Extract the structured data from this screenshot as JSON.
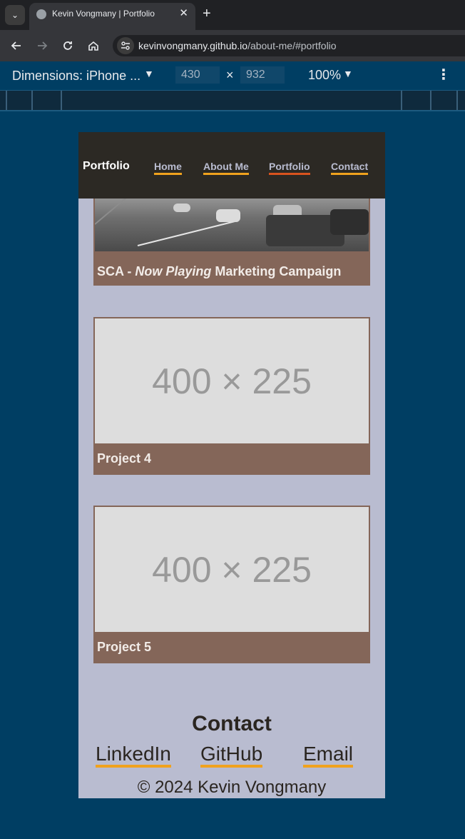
{
  "browser": {
    "tab_title": "Kevin Vongmany | Portfolio",
    "tab_close_glyph": "✕",
    "new_tab_glyph": "+",
    "tab_menu_glyph": "⌄",
    "url_host": "kevinvongmany.github.io",
    "url_path": "/about-me/#portfolio",
    "icons": [
      "globe-icon",
      "back-arrow-icon",
      "forward-arrow-icon",
      "reload-icon",
      "home-icon",
      "site-settings-icon"
    ]
  },
  "devtools": {
    "device_label": "Dimensions: iPhone ...",
    "width_value": "430",
    "height_value": "932",
    "times_glyph": "×",
    "zoom_label": "100%"
  },
  "site": {
    "brand": "Portfolio",
    "nav": [
      {
        "label": "Home",
        "active": false
      },
      {
        "label": "About Me",
        "active": false
      },
      {
        "label": "Portfolio",
        "active": true
      },
      {
        "label": "Contact",
        "active": false
      }
    ],
    "projects": [
      {
        "caption_prefix": "SCA - ",
        "caption_italic": "Now Playing",
        "caption_suffix": " Marketing Campaign"
      },
      {
        "placeholder": "400 × 225",
        "caption": "Project 4"
      },
      {
        "placeholder": "400 × 225",
        "caption": "Project 5"
      }
    ],
    "contact": {
      "heading": "Contact",
      "links": [
        "LinkedIn",
        "GitHub",
        "Email"
      ]
    },
    "copyright": "© 2024 Kevin Vongmany"
  },
  "colors": {
    "page_bg": "#003e63",
    "site_bg": "#b9bcd0",
    "nav_bg": "#2c2924",
    "card_bg": "#846659",
    "underline_accent": "#f0a21d",
    "active_underline": "#d9531e"
  }
}
